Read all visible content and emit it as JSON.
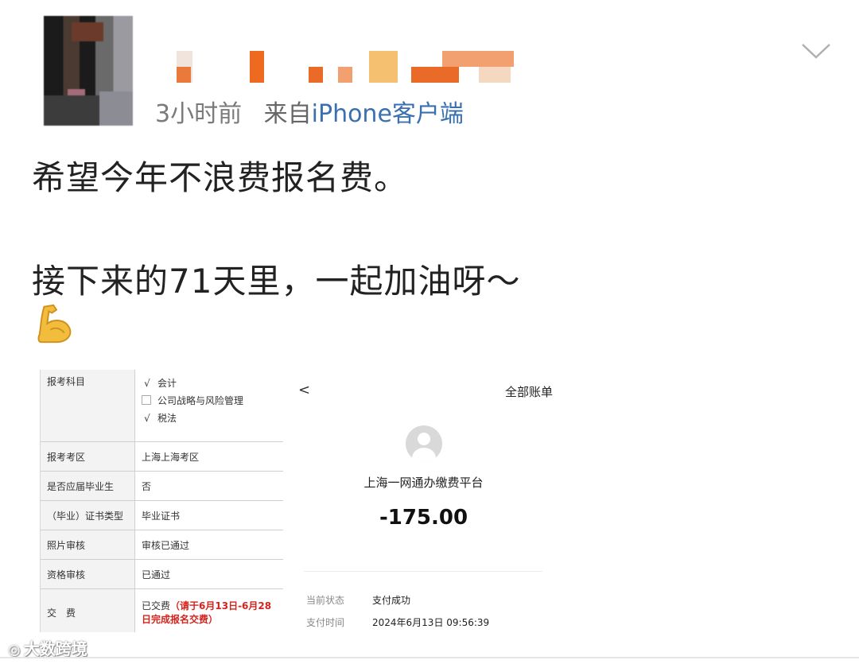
{
  "post": {
    "time": "3小时前",
    "source_prefix": "来自",
    "device": "iPhone客户端",
    "line1": "希望今年不浪费报名费。",
    "line2": "接下来的71天里，一起加油呀～",
    "emoji": "flexed-biceps"
  },
  "registration": {
    "rows": [
      {
        "label": "报考科目",
        "options": [
          {
            "checked": true,
            "text": "会计"
          },
          {
            "checked": false,
            "text": "公司战略与风险管理"
          },
          {
            "checked": true,
            "text": "税法"
          }
        ]
      },
      {
        "label": "报考考区",
        "value": "上海上海考区"
      },
      {
        "label": "是否应届毕业生",
        "value": "否"
      },
      {
        "label": "（毕业）证书类型",
        "value": "毕业证书"
      },
      {
        "label": "照片审核",
        "value": "审核已通过"
      },
      {
        "label": "资格审核",
        "value": "已通过"
      },
      {
        "label": "交　费",
        "value": "已交费",
        "note": "（请于6月13日-6月28日完成报名交费）"
      }
    ]
  },
  "bill": {
    "back_glyph": "<",
    "title": "全部账单",
    "merchant": "上海一网通办缴费平台",
    "amount": "-175.00",
    "status_label": "当前状态",
    "status_value": "支付成功",
    "time_label": "支付时间",
    "time_value": "2024年6月13日 09:56:39"
  },
  "watermark": "大数跨境",
  "colors": {
    "link_blue": "#3a6fb0",
    "alert_red": "#d3241e"
  }
}
